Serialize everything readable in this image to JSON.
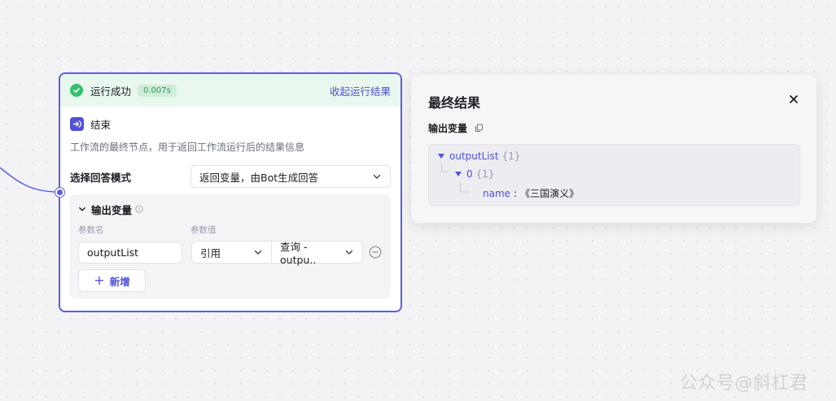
{
  "node": {
    "run_status": "运行成功",
    "run_time": "0.007s",
    "collapse_label": "收起运行结果",
    "title": "结束",
    "description": "工作流的最终节点，用于返回工作流运行后的结果信息",
    "answer_mode_label": "选择回答模式",
    "answer_mode_value": "返回变量，由Bot生成回答",
    "output": {
      "title": "输出变量",
      "col_name": "参数名",
      "col_value": "参数值",
      "var_name": "outputList",
      "ref_type": "引用",
      "ref_value": "查询 - outpu..",
      "add_label": "新增"
    }
  },
  "result": {
    "title": "最终结果",
    "subtitle": "输出变量",
    "tree": {
      "root_key": "outputList",
      "root_count": "{1}",
      "child_key": "0",
      "child_count": "{1}",
      "leaf_key": "name",
      "leaf_value": "《三国演义》"
    }
  },
  "watermark": "公众号@斜杠君",
  "colors": {
    "accent": "#4e50d6",
    "success": "#34c06a",
    "node_border": "#5b5ee0"
  },
  "icons": [
    "check-circle-icon",
    "end-node-icon",
    "chevron-down-icon",
    "info-icon",
    "remove-circle-icon",
    "plus-icon",
    "close-icon",
    "copy-icon",
    "caret-down-icon"
  ]
}
